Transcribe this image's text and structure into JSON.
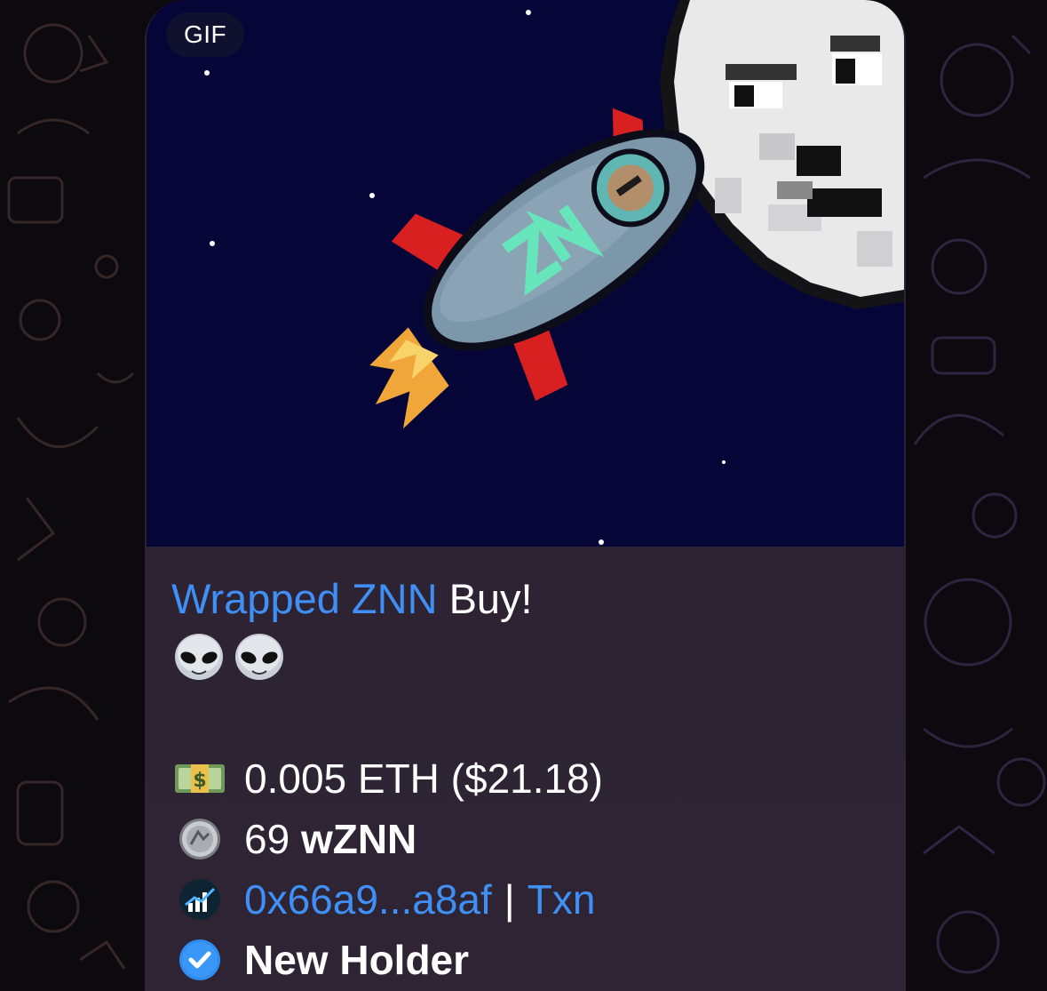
{
  "media": {
    "badge": "GIF"
  },
  "message": {
    "token_link": "Wrapped ZNN",
    "headline_suffix": " Buy!",
    "emojis": [
      "alien-icon",
      "alien-icon"
    ],
    "spent": "0.005 ETH ($21.18)",
    "amount_number": "69 ",
    "amount_token": "wZNN",
    "buyer_link": "0x66a9...a8af",
    "separator": "|",
    "txn_link": "Txn",
    "holder_status": "New Holder"
  },
  "colors": {
    "link": "#3f8ff5",
    "bubble": "#2b2231",
    "gif_background": "#050537",
    "check_badge": "#2f8cf0"
  }
}
